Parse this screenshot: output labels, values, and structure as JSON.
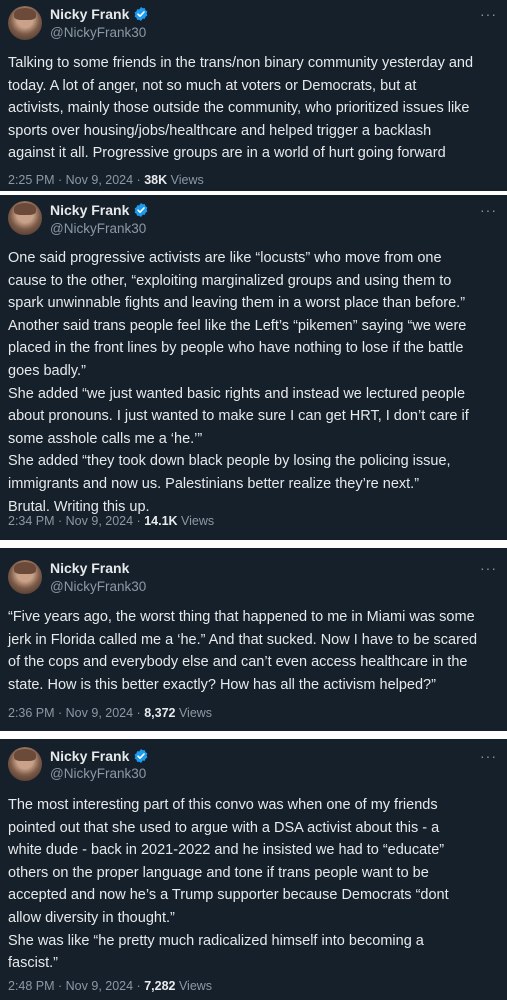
{
  "tweets": [
    {
      "name": "Nicky Frank",
      "handle": "@NickyFrank30",
      "lines": [
        "Talking to some friends in the trans/non binary community yesterday and",
        "today. A lot of anger, not so much at voters or Democrats, but at",
        "activists, mainly those outside the community, who prioritized issues like",
        "sports over housing/jobs/healthcare and helped trigger a backlash",
        "against it all. Progressive groups are in a world of hurt going forward"
      ],
      "timestamp": "2:25 PM · Nov 9, 2024 · ",
      "views_count": "38K",
      "views_label": " Views"
    },
    {
      "name": "Nicky Frank",
      "handle": "@NickyFrank30",
      "lines": [
        "One said progressive activists are like “locusts” who move from one",
        "cause to the other, “exploiting marginalized groups and using them to",
        "spark unwinnable fights and leaving them in a worst place than before.”",
        "Another said trans people feel like the Left’s “pikemen” saying “we were",
        "placed in the front lines by people who have nothing to lose if the battle",
        "goes badly.”",
        "She added “we just wanted basic rights and instead we lectured people",
        "about pronouns. I just wanted to make sure I can get HRT, I don’t care if",
        "some asshole calls me a ‘he.’”",
        "She added “they took down black people by losing the policing issue,",
        "immigrants and now us. Palestinians better realize they’re next.”",
        "Brutal. Writing this up."
      ],
      "timestamp": "2:34 PM · Nov 9, 2024 · ",
      "views_count": "14.1K",
      "views_label": " Views"
    },
    {
      "name": "Nicky Frank",
      "handle": "@NickyFrank30",
      "lines": [
        "“Five years ago, the worst thing that happened to me in Miami was some",
        "jerk in Florida called me a ‘he.” And that sucked. Now I have to be scared",
        "of the cops and everybody else and can’t even access healthcare in the",
        "state. How is this better exactly? How has all the activism helped?”"
      ],
      "timestamp": "2:36 PM · Nov 9, 2024 · ",
      "views_count": "8,372",
      "views_label": " Views"
    },
    {
      "name": "Nicky Frank",
      "handle": "@NickyFrank30",
      "lines": [
        "The most interesting part of this convo was when one of my friends",
        "pointed out that she used to argue with a DSA activist about this - a",
        "white dude - back in 2021-2022 and he insisted we had to “educate”",
        "others on the proper language and tone if trans people want to be",
        "accepted and now he’s a Trump supporter because Democrats “dont",
        "allow diversity in thought.”",
        "She was like “he pretty much radicalized himself into becoming a",
        "fascist.”"
      ],
      "timestamp": "2:48 PM · Nov 9, 2024 · ",
      "views_count": "7,282",
      "views_label": " Views"
    }
  ],
  "colors": {
    "background": "#15202b",
    "text": "#e7e9ea",
    "muted": "#8b98a5",
    "verified": "#1d9bf0"
  },
  "icons": {
    "verified": "verified-badge-icon",
    "more": "more-icon"
  }
}
